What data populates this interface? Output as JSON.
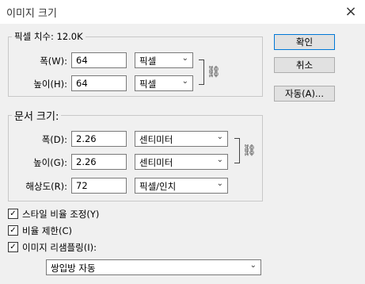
{
  "window": {
    "title": "이미지 크기",
    "close_icon": "×"
  },
  "pixel_dims": {
    "legend": "픽셀 치수: 12.0K",
    "width_label": "폭(W):",
    "width_value": "64",
    "width_unit": "픽셀",
    "height_label": "높이(H):",
    "height_value": "64",
    "height_unit": "픽셀"
  },
  "doc_size": {
    "legend": "문서 크기:",
    "width_label": "폭(D):",
    "width_value": "2.26",
    "width_unit": "센티미터",
    "height_label": "높이(G):",
    "height_value": "2.26",
    "height_unit": "센티미터",
    "res_label": "해상도(R):",
    "res_value": "72",
    "res_unit": "픽셀/인치"
  },
  "buttons": {
    "ok": "확인",
    "cancel": "취소",
    "auto": "자동(A)..."
  },
  "options": {
    "scale_styles": "스타일 비율 조정(Y)",
    "constrain": "비율 제한(C)",
    "resample": "이미지 리샘플링(I):",
    "resample_method": "쌍입방 자동"
  }
}
